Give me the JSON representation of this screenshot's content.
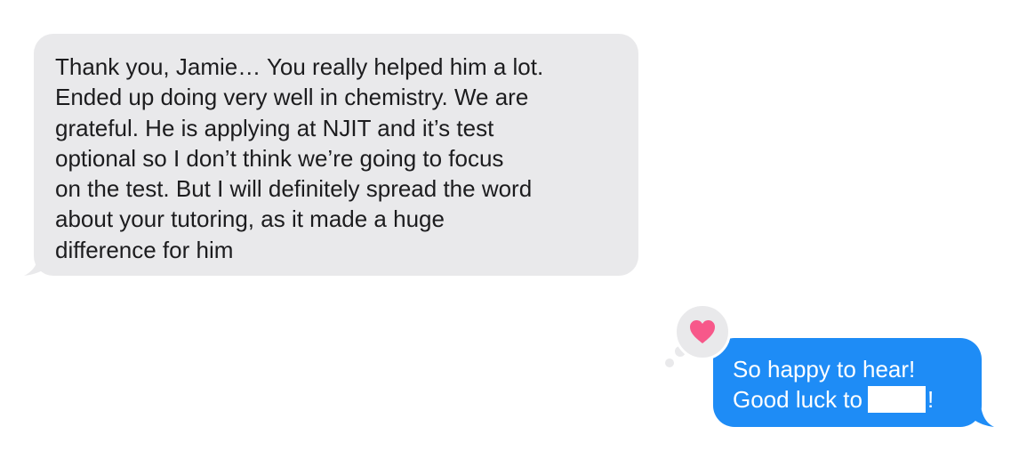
{
  "thread": {
    "incoming": {
      "lines": [
        "Thank you, Jamie… You really helped him a lot.",
        "Ended up doing very well in chemistry. We are",
        "grateful. He is applying at NJIT and it’s test",
        "optional so I don’t think we’re going to focus",
        "on the test. But I will definitely spread the word",
        "about your tutoring, as it made a huge",
        "difference for him"
      ],
      "bubble_color": "#e9e9eb",
      "text_color": "#1c1c1e"
    },
    "outgoing": {
      "line1": "So happy to hear!",
      "line2_prefix": "Good luck to",
      "line2_suffix": "!",
      "bubble_color": "#1e8cf6",
      "text_color": "#ffffff",
      "redacted": true
    },
    "reaction": {
      "icon": "heart-icon",
      "color": "#f7588a",
      "background": "#e9e9eb"
    }
  }
}
